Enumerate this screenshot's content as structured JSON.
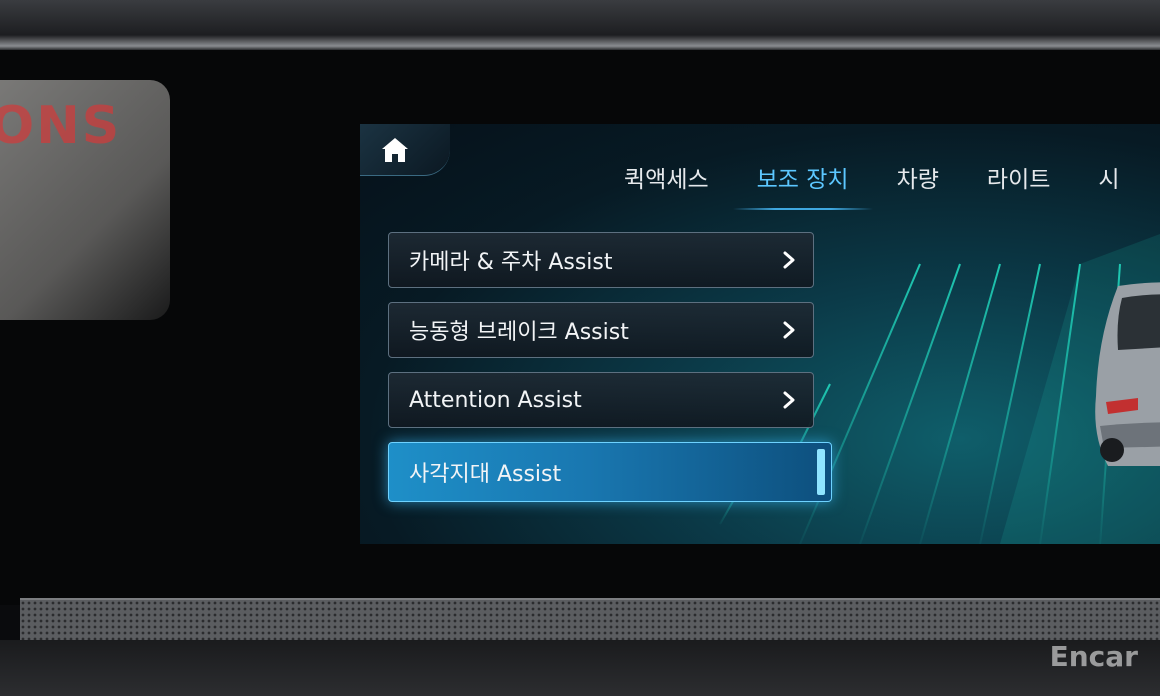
{
  "home": {
    "icon": "home-icon"
  },
  "tabs": [
    {
      "label": "퀵액세스",
      "active": false
    },
    {
      "label": "보조 장치",
      "active": true
    },
    {
      "label": "차량",
      "active": false
    },
    {
      "label": "라이트",
      "active": false
    },
    {
      "label": "시",
      "active": false
    }
  ],
  "menu": [
    {
      "label": "카메라 & 주차 Assist",
      "icon": "chevron-right-icon"
    },
    {
      "label": "능동형 브레이크 Assist",
      "icon": "chevron-right-icon"
    },
    {
      "label": "Attention Assist",
      "icon": "chevron-right-icon"
    },
    {
      "label": "사각지대 Assist",
      "selected": true
    }
  ],
  "watermark": "Encar",
  "reflection_text": "ONS",
  "colors": {
    "accent": "#5cc7ff",
    "selected_bg": "#1977b0",
    "grid": "#22e0c4"
  }
}
